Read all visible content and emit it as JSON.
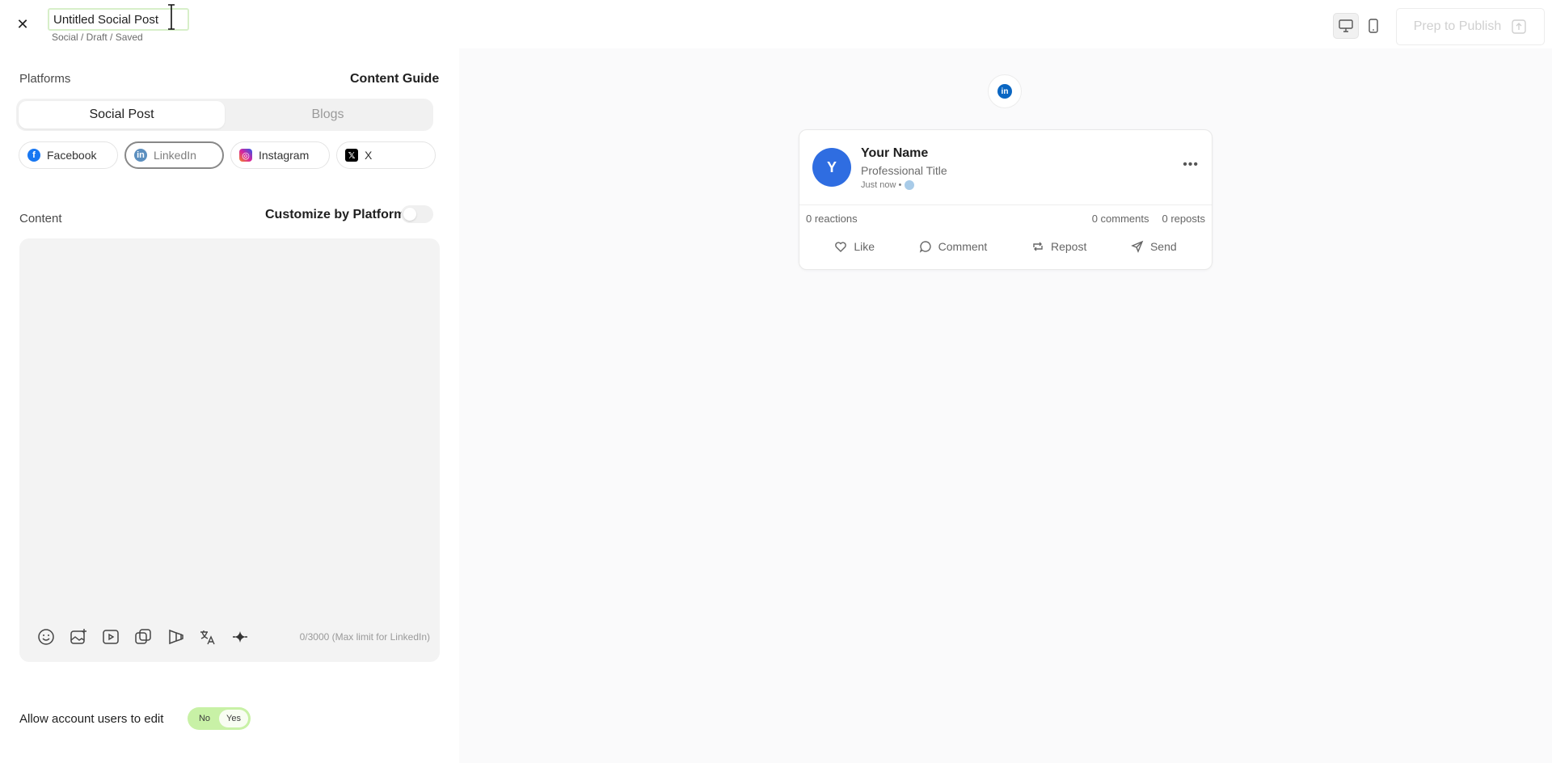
{
  "header": {
    "title_value": "Untitled Social Post",
    "breadcrumb": "Social / Draft / Saved",
    "publish_label": "Prep to Publish"
  },
  "platforms_section": {
    "label": "Platforms",
    "guide_link": "Content Guide",
    "tabs": [
      {
        "label": "Social Post",
        "active": true
      },
      {
        "label": "Blogs",
        "active": false
      }
    ],
    "chips": [
      {
        "label": "Facebook",
        "icon": "facebook-icon",
        "color": "#1877f2",
        "selected": false
      },
      {
        "label": "LinkedIn",
        "icon": "linkedin-icon",
        "color": "#5c8fbf",
        "selected": true
      },
      {
        "label": "Instagram",
        "icon": "instagram-icon",
        "color": "#d6249f",
        "selected": false
      },
      {
        "label": "X",
        "icon": "x-icon",
        "color": "#000000",
        "selected": false
      }
    ]
  },
  "content_section": {
    "label": "Content",
    "customize_label": "Customize by Platform",
    "customize_on": false,
    "editor_value": "",
    "counter": "0/3000 (Max limit for LinkedIn)",
    "tools": [
      "emoji-icon",
      "image-icon",
      "video-icon",
      "gallery-icon",
      "carousel-icon",
      "translate-icon",
      "ai-sparkle-icon"
    ]
  },
  "permissions": {
    "label": "Allow account users to edit",
    "no_label": "No",
    "yes_label": "Yes",
    "value": "Yes"
  },
  "preview": {
    "platform_icon": "in",
    "avatar_letter": "Y",
    "name": "Your Name",
    "professional_title": "Professional Title",
    "time": "Just now •",
    "reactions": "0 reactions",
    "comments": "0 comments",
    "reposts": "0 reposts",
    "actions": [
      "Like",
      "Comment",
      "Repost",
      "Send"
    ]
  }
}
